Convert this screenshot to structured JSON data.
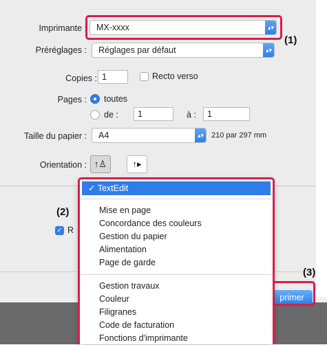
{
  "printer": {
    "label": "Imprimante :",
    "value": "MX-xxxx"
  },
  "presets": {
    "label": "Préréglages :",
    "value": "Réglages par défaut"
  },
  "copies": {
    "label": "Copies :",
    "value": "1",
    "duplex_label": "Recto verso"
  },
  "pages": {
    "label": "Pages :",
    "all_label": "toutes",
    "from_label": "de :",
    "from_value": "1",
    "to_label": "à :",
    "to_value": "1"
  },
  "paper": {
    "label": "Taille du papier :",
    "value": "A4",
    "size_text": "210 par 297 mm"
  },
  "orientation": {
    "label": "Orientation :"
  },
  "menu": {
    "selected": "TextEdit",
    "group1": [
      "Mise en page",
      "Concordance des couleurs",
      "Gestion du papier",
      "Alimentation",
      "Page de garde"
    ],
    "group2": [
      "Gestion travaux",
      "Couleur",
      "Filigranes",
      "Code de facturation",
      "Fonctions d'imprimante"
    ]
  },
  "print_button": "primer",
  "partial_label": "R",
  "callouts": {
    "c1": "(1)",
    "c2": "(2)",
    "c3": "(3)"
  },
  "colors": {
    "accent": "#2f7de6",
    "highlight": "#d51f4c"
  }
}
